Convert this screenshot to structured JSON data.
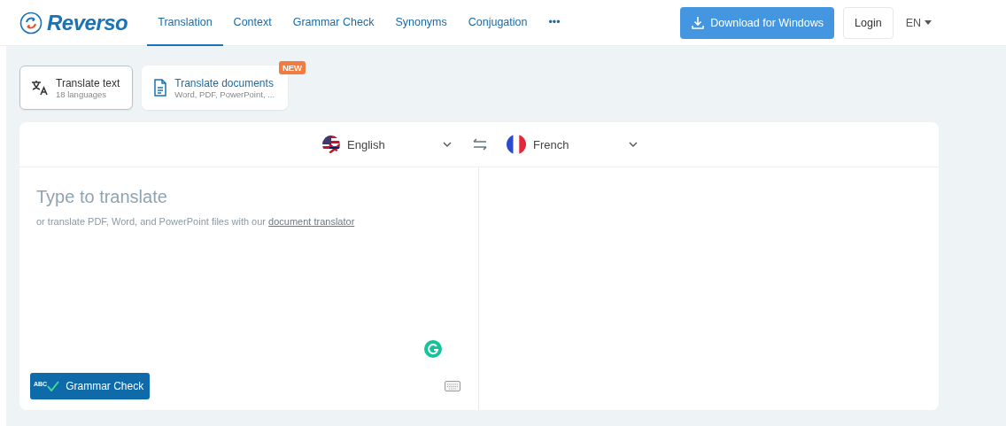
{
  "logo": {
    "text": "Reverso"
  },
  "nav": [
    {
      "label": "Translation",
      "selected": true
    },
    {
      "label": "Context",
      "selected": false
    },
    {
      "label": "Grammar Check",
      "selected": false
    },
    {
      "label": "Synonyms",
      "selected": false
    },
    {
      "label": "Conjugation",
      "selected": false
    },
    {
      "label": "•••",
      "selected": false
    }
  ],
  "download_button": "Download for Windows",
  "login_button": "Login",
  "language_menu": "EN",
  "modes": [
    {
      "kind": "text",
      "title": "Translate text",
      "subtitle": "18 languages",
      "selected": true
    },
    {
      "kind": "documents",
      "title": "Translate documents",
      "subtitle": "Word, PDF, PowerPoint, ...",
      "badge": "NEW",
      "selected": false
    }
  ],
  "source_language": {
    "kind": "uk",
    "label": "English"
  },
  "target_language": {
    "kind": "fr",
    "label": "French"
  },
  "input": {
    "placeholder": "Type to translate",
    "hint": "or translate PDF, Word, and PowerPoint files with our",
    "hint_link": "document translator"
  },
  "grammar_button": {
    "badge": "ABC",
    "label": "Grammar Check"
  }
}
